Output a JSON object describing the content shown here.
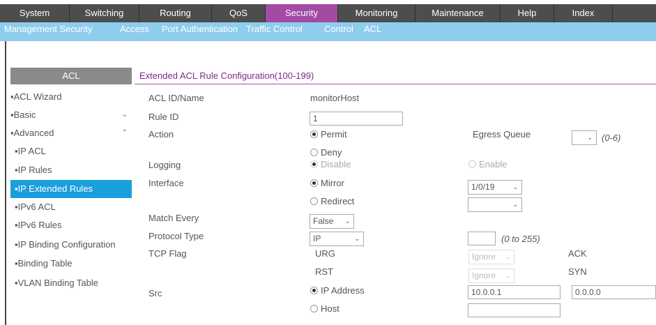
{
  "topnav": [
    {
      "label": "System",
      "active": false
    },
    {
      "label": "Switching",
      "active": false
    },
    {
      "label": "Routing",
      "active": false
    },
    {
      "label": "QoS",
      "active": false
    },
    {
      "label": "Security",
      "active": true
    },
    {
      "label": "Monitoring",
      "active": false
    },
    {
      "label": "Maintenance",
      "active": false
    },
    {
      "label": "Help",
      "active": false
    },
    {
      "label": "Index",
      "active": false
    }
  ],
  "subnav": [
    {
      "label": "Management Security",
      "active": false
    },
    {
      "label": "Access",
      "active": false
    },
    {
      "label": "Port Authentication",
      "active": false
    },
    {
      "label": "Traffic Control",
      "active": false
    },
    {
      "label": "Control",
      "active": false
    },
    {
      "label": "ACL",
      "active": true
    }
  ],
  "sidebar": {
    "header": "ACL",
    "items": [
      {
        "label": "▪ACL Wizard",
        "chev": ""
      },
      {
        "label": "▪Basic",
        "chev": "⌄"
      },
      {
        "label": "▪Advanced",
        "chev": "⌃"
      },
      {
        "label": "▪IP ACL",
        "chev": ""
      },
      {
        "label": "▪IP Rules",
        "chev": ""
      },
      {
        "label": "▪IP Extended Rules",
        "chev": ""
      },
      {
        "label": "▪IPv6 ACL",
        "chev": ""
      },
      {
        "label": "▪IPv6 Rules",
        "chev": ""
      },
      {
        "label": "▪IP Binding Configuration",
        "chev": ""
      },
      {
        "label": "▪Binding Table",
        "chev": ""
      },
      {
        "label": "▪VLAN Binding Table",
        "chev": ""
      }
    ]
  },
  "main": {
    "title": "Extended ACL Rule Configuration(100-199)",
    "labels": {
      "acl_id": "ACL ID/Name",
      "rule_id": "Rule ID",
      "action": "Action",
      "logging": "Logging",
      "interface": "Interface",
      "match_every": "Match Every",
      "protocol_type": "Protocol Type",
      "tcp_flag": "TCP Flag",
      "src": "Src",
      "egress_queue": "Egress Queue"
    },
    "acl_id_value": "monitorHost",
    "rule_id_value": "1",
    "action_options": {
      "permit": "Permit",
      "deny": "Deny"
    },
    "logging_options": {
      "disable": "Disable",
      "enable": "Enable"
    },
    "interface_options": {
      "mirror": "Mirror",
      "redirect": "Redirect"
    },
    "egress_queue_value": "",
    "egress_queue_hint": "(0-6)",
    "interface_port_value": "1/0/19",
    "redirect_port_value": "",
    "match_every_value": "False",
    "protocol_type_value": "IP",
    "protocol_number_value": "",
    "protocol_hint": "(0 to 255)",
    "tcp_flags": {
      "urg": "URG",
      "rst": "RST",
      "ack": "ACK",
      "syn": "SYN"
    },
    "tcp_flag_select": "Ignore",
    "src_options": {
      "ip": "IP Address",
      "host": "Host"
    },
    "src_ip_value": "10.0.0.1",
    "src_mask_value": "0.0.0.0",
    "src_host_value": ""
  }
}
